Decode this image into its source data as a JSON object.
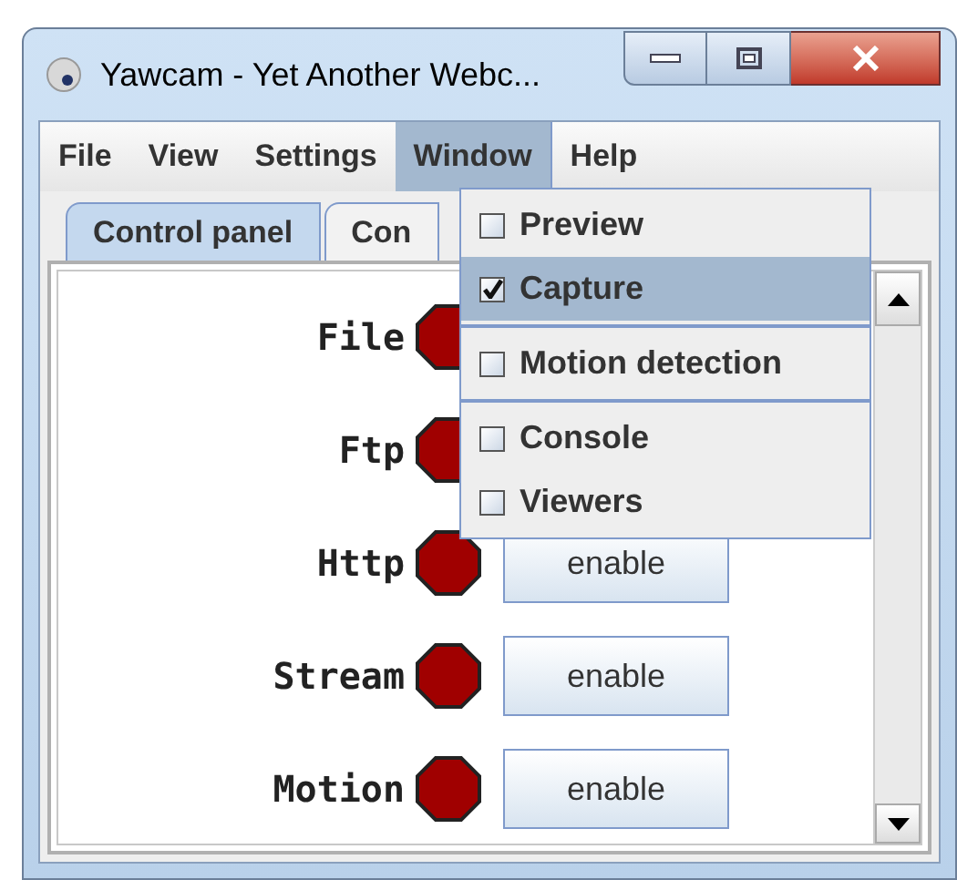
{
  "window": {
    "title": "Yawcam - Yet Another Webc..."
  },
  "menu_bar": [
    {
      "label": "File",
      "selected": false
    },
    {
      "label": "View",
      "selected": false
    },
    {
      "label": "Settings",
      "selected": false
    },
    {
      "label": "Window",
      "selected": true
    },
    {
      "label": "Help",
      "selected": false
    }
  ],
  "tabs": [
    {
      "label": "Control panel",
      "selected": true
    },
    {
      "label": "Con",
      "selected": false
    }
  ],
  "services": [
    {
      "name": "File",
      "running": false
    },
    {
      "name": "Ftp",
      "running": false
    },
    {
      "name": "Http",
      "running": false,
      "button": "enable"
    },
    {
      "name": "Stream",
      "running": false,
      "button": "enable"
    },
    {
      "name": "Motion",
      "running": false,
      "button": "enable"
    }
  ],
  "window_menu": [
    {
      "kind": "item",
      "label": "Preview",
      "checked": false,
      "selected": false
    },
    {
      "kind": "item",
      "label": "Capture",
      "checked": true,
      "selected": true
    },
    {
      "kind": "separator"
    },
    {
      "kind": "item",
      "label": "Motion detection",
      "checked": false,
      "selected": false
    },
    {
      "kind": "separator"
    },
    {
      "kind": "item",
      "label": "Console",
      "checked": false,
      "selected": false
    },
    {
      "kind": "item",
      "label": "Viewers",
      "checked": false,
      "selected": false
    }
  ]
}
